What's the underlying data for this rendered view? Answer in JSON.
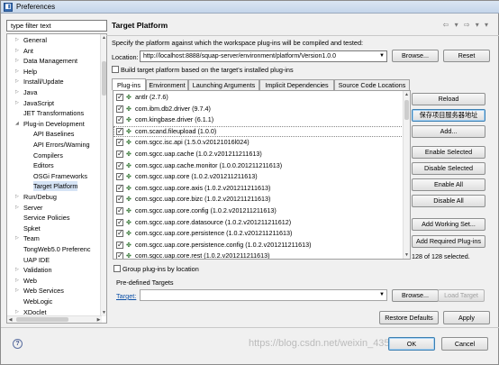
{
  "window": {
    "title": "Preferences"
  },
  "sidebar": {
    "filter_placeholder": "type filter text",
    "items": [
      {
        "label": "General",
        "indent": 0
      },
      {
        "label": "Ant",
        "indent": 0
      },
      {
        "label": "Data Management",
        "indent": 0
      },
      {
        "label": "Help",
        "indent": 0
      },
      {
        "label": "Install/Update",
        "indent": 0
      },
      {
        "label": "Java",
        "indent": 0
      },
      {
        "label": "JavaScript",
        "indent": 0
      },
      {
        "label": "JET Transformations",
        "indent": 0
      },
      {
        "label": "Plug-in Development",
        "indent": 0
      },
      {
        "label": "API Baselines",
        "indent": 1
      },
      {
        "label": "API Errors/Warning",
        "indent": 1
      },
      {
        "label": "Compilers",
        "indent": 1
      },
      {
        "label": "Editors",
        "indent": 1
      },
      {
        "label": "OSGi Frameworks",
        "indent": 1
      },
      {
        "label": "Target Platform",
        "indent": 1,
        "selected": true
      },
      {
        "label": "Run/Debug",
        "indent": 0
      },
      {
        "label": "Server",
        "indent": 0
      },
      {
        "label": "Service Policies",
        "indent": 0
      },
      {
        "label": "Spket",
        "indent": 0
      },
      {
        "label": "Team",
        "indent": 0
      },
      {
        "label": "TongWeb5.0 Preferenc",
        "indent": 0
      },
      {
        "label": "UAP IDE",
        "indent": 0
      },
      {
        "label": "Validation",
        "indent": 0
      },
      {
        "label": "Web",
        "indent": 0
      },
      {
        "label": "Web Services",
        "indent": 0
      },
      {
        "label": "WebLogic",
        "indent": 0
      },
      {
        "label": "XDoclet",
        "indent": 0
      }
    ],
    "scroll_up_glyph": "▲",
    "scroll_down_glyph": "▼",
    "scroll_left_glyph": "◀",
    "scroll_right_glyph": "▶"
  },
  "main": {
    "page_title": "Target Platform",
    "nav_tools": "⇦ ▾ ⇨ ▾ ▾",
    "description": "Specify the platform against which the workspace plug-ins will be compiled and tested:",
    "location_label": "Location:",
    "location_value": "http://localhost:8888/squap-server/environment/platform/Version1.0.0",
    "browse_label": "Browse...",
    "reset_label": "Reset",
    "build_target_label": "Build target platform based on the target's installed plug-ins",
    "tabs": [
      {
        "label": "Plug-ins",
        "active": true
      },
      {
        "label": "Environment"
      },
      {
        "label": "Launching Arguments"
      },
      {
        "label": "Implicit Dependencies"
      },
      {
        "label": "Source Code Locations"
      }
    ],
    "plugins": [
      {
        "name": "antlr (2.7.6)",
        "checked": true
      },
      {
        "name": "com.ibm.db2.driver (9.7.4)",
        "checked": true
      },
      {
        "name": "com.kingbase.driver (6.1.1)",
        "checked": true
      },
      {
        "name": "com.scand.fileupload (1.0.0)",
        "checked": true
      },
      {
        "name": "com.sgcc.isc.api (1.5.0.v20121016l024)",
        "checked": true
      },
      {
        "name": "com.sgcc.uap.cache (1.0.2.v201211211613)",
        "checked": true
      },
      {
        "name": "com.sgcc.uap.cache.monitor (1.0.0.201211211613)",
        "checked": true
      },
      {
        "name": "com.sgcc.uap.core (1.0.2.v201211211613)",
        "checked": true
      },
      {
        "name": "com.sgcc.uap.core.axis (1.0.2.v201211211613)",
        "checked": true
      },
      {
        "name": "com.sgcc.uap.core.bizc (1.0.2.v201211211613)",
        "checked": true
      },
      {
        "name": "com.sgcc.uap.core.config (1.0.2.v201211211613)",
        "checked": true
      },
      {
        "name": "com.sgcc.uap.core.datasource (1.0.2.v201211211612)",
        "checked": true
      },
      {
        "name": "com.sgcc.uap.core.persistence (1.0.2.v201211211613)",
        "checked": true
      },
      {
        "name": "com.sgcc.uap.core.persistence.config (1.0.2.v201211211613)",
        "checked": true
      },
      {
        "name": "com.sgcc.uap.core.rest (1.0.2.v201211211613)",
        "checked": true
      }
    ],
    "plugin_icon_glyph": "✤",
    "check_glyph": "✓",
    "side_buttons": {
      "reload": "Reload",
      "save_address": "保存项目服务器地址",
      "add": "Add...",
      "enable_selected": "Enable Selected",
      "disable_selected": "Disable Selected",
      "enable_all": "Enable All",
      "disable_all": "Disable All",
      "add_working_set": "Add Working Set...",
      "add_required": "Add Required Plug-ins"
    },
    "selection_count": "128 of 128 selected.",
    "group_by_location_label": "Group plug-ins by location",
    "predefined_label": "Pre-defined Targets",
    "target_link": "Target:",
    "target_browse": "Browse...",
    "load_target": "Load Target",
    "restore_defaults": "Restore Defaults",
    "apply": "Apply"
  },
  "footer": {
    "help_glyph": "?",
    "ok_label": "OK",
    "cancel_label": "Cancel",
    "watermark": "https://blog.csdn.net/weixin_43559670"
  },
  "colors": {
    "selection": "#d5e3f5",
    "link": "#0b4fa6",
    "title_gradient_top": "#dbe6f3"
  }
}
